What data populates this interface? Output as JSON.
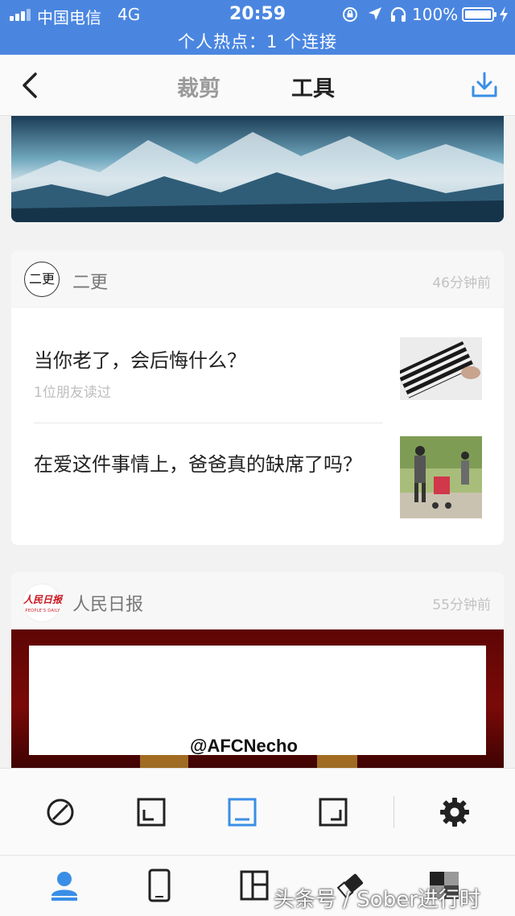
{
  "status_bar": {
    "carrier": "中国电信",
    "network": "4G",
    "time": "20:59",
    "battery": "100%",
    "hotspot": "个人热点：1 个连接",
    "background_color": "#4a86e0"
  },
  "nav": {
    "tabs": [
      "裁剪",
      "工具"
    ],
    "active_tab": "工具",
    "icons": [
      "back-chevron",
      "download"
    ],
    "accent_color": "#3a8ee6"
  },
  "feed": {
    "card1": {
      "author": "二更",
      "avatar_text": "二更",
      "time": "46分钟前",
      "articles": [
        {
          "title": "当你老了，会后悔什么？",
          "meta": "1位朋友读过"
        },
        {
          "title": "在爱这件事情上，爸爸真的缺席了吗？"
        }
      ]
    },
    "card2": {
      "author": "人民日报",
      "logo_text": "人民日报",
      "logo_sub": "PEOPLE'S DAILY",
      "time": "55分钟前"
    }
  },
  "watermark": "@AFCNecho",
  "toolbar": {
    "icons": [
      "no-border",
      "corner-bottom-left",
      "edge-bottom",
      "corner-bottom-right",
      "settings-gear"
    ],
    "active": "edge-bottom"
  },
  "bottom_bar": {
    "icons": [
      "person",
      "phone",
      "layout",
      "eraser",
      "mosaic"
    ],
    "active": "person"
  },
  "credit": "头条号 / Sober进行时"
}
